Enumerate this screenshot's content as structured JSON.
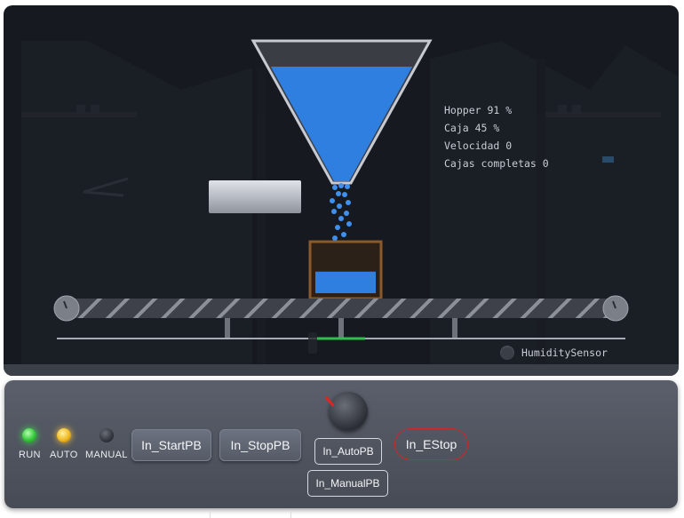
{
  "readouts": {
    "hopper": "Hopper 91 %",
    "caja": "Caja 45 %",
    "velocidad": "Velocidad 0",
    "cajas_completas": "Cajas completas 0"
  },
  "hopper_level": 0.91,
  "box_level": 0.45,
  "sensor": {
    "label": "HumiditySensor"
  },
  "lamps": [
    {
      "label": "RUN",
      "state": "on",
      "color": "#3ae14a"
    },
    {
      "label": "AUTO",
      "state": "on",
      "color": "#ffc43a"
    },
    {
      "label": "MANUAL",
      "state": "off",
      "color": "#3a3e46"
    }
  ],
  "buttons": {
    "start": "In_StartPB",
    "stop": "In_StopPB",
    "auto": "In_AutoPB",
    "manual": "In_ManualPB",
    "estop": "In_EStop"
  },
  "colors": {
    "water": "#2f7fe0",
    "box_wood": "#8a5a2b",
    "estop": "#c92a2a",
    "sensor_active": "#2fbf4f"
  }
}
